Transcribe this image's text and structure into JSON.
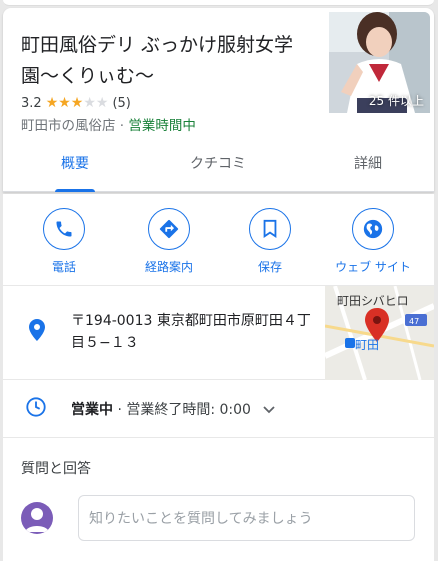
{
  "place": {
    "name": "町田風俗デリ ぶっかけ服射女学園〜くりぃむ〜",
    "rating": "3.2",
    "stars_filled": 3,
    "stars_total": 5,
    "review_count": "(5)",
    "category": "町田市の風俗店",
    "separator": " · ",
    "status": "営業時間中",
    "photo_count": "25 件以上"
  },
  "tabs": [
    {
      "label": "概要"
    },
    {
      "label": "クチコミ"
    },
    {
      "label": "詳細"
    }
  ],
  "actions": [
    {
      "label": "電話",
      "icon": "phone-icon"
    },
    {
      "label": "経路案内",
      "icon": "directions-icon"
    },
    {
      "label": "保存",
      "icon": "bookmark-icon"
    },
    {
      "label": "ウェブ サイト",
      "icon": "globe-icon"
    }
  ],
  "address": {
    "text": "〒194-0013 東京都町田市原町田４丁目５−１３"
  },
  "map": {
    "label_top": "町田シバヒロ",
    "label_station": "町田"
  },
  "hours": {
    "status": "営業中",
    "detail": " · 営業終了時間: 0:00"
  },
  "qa": {
    "title": "質問と回答",
    "placeholder": "知りたいことを質問してみましょう"
  },
  "colors": {
    "accent": "#1a73e8",
    "open": "#188038",
    "star": "#f5a623"
  }
}
